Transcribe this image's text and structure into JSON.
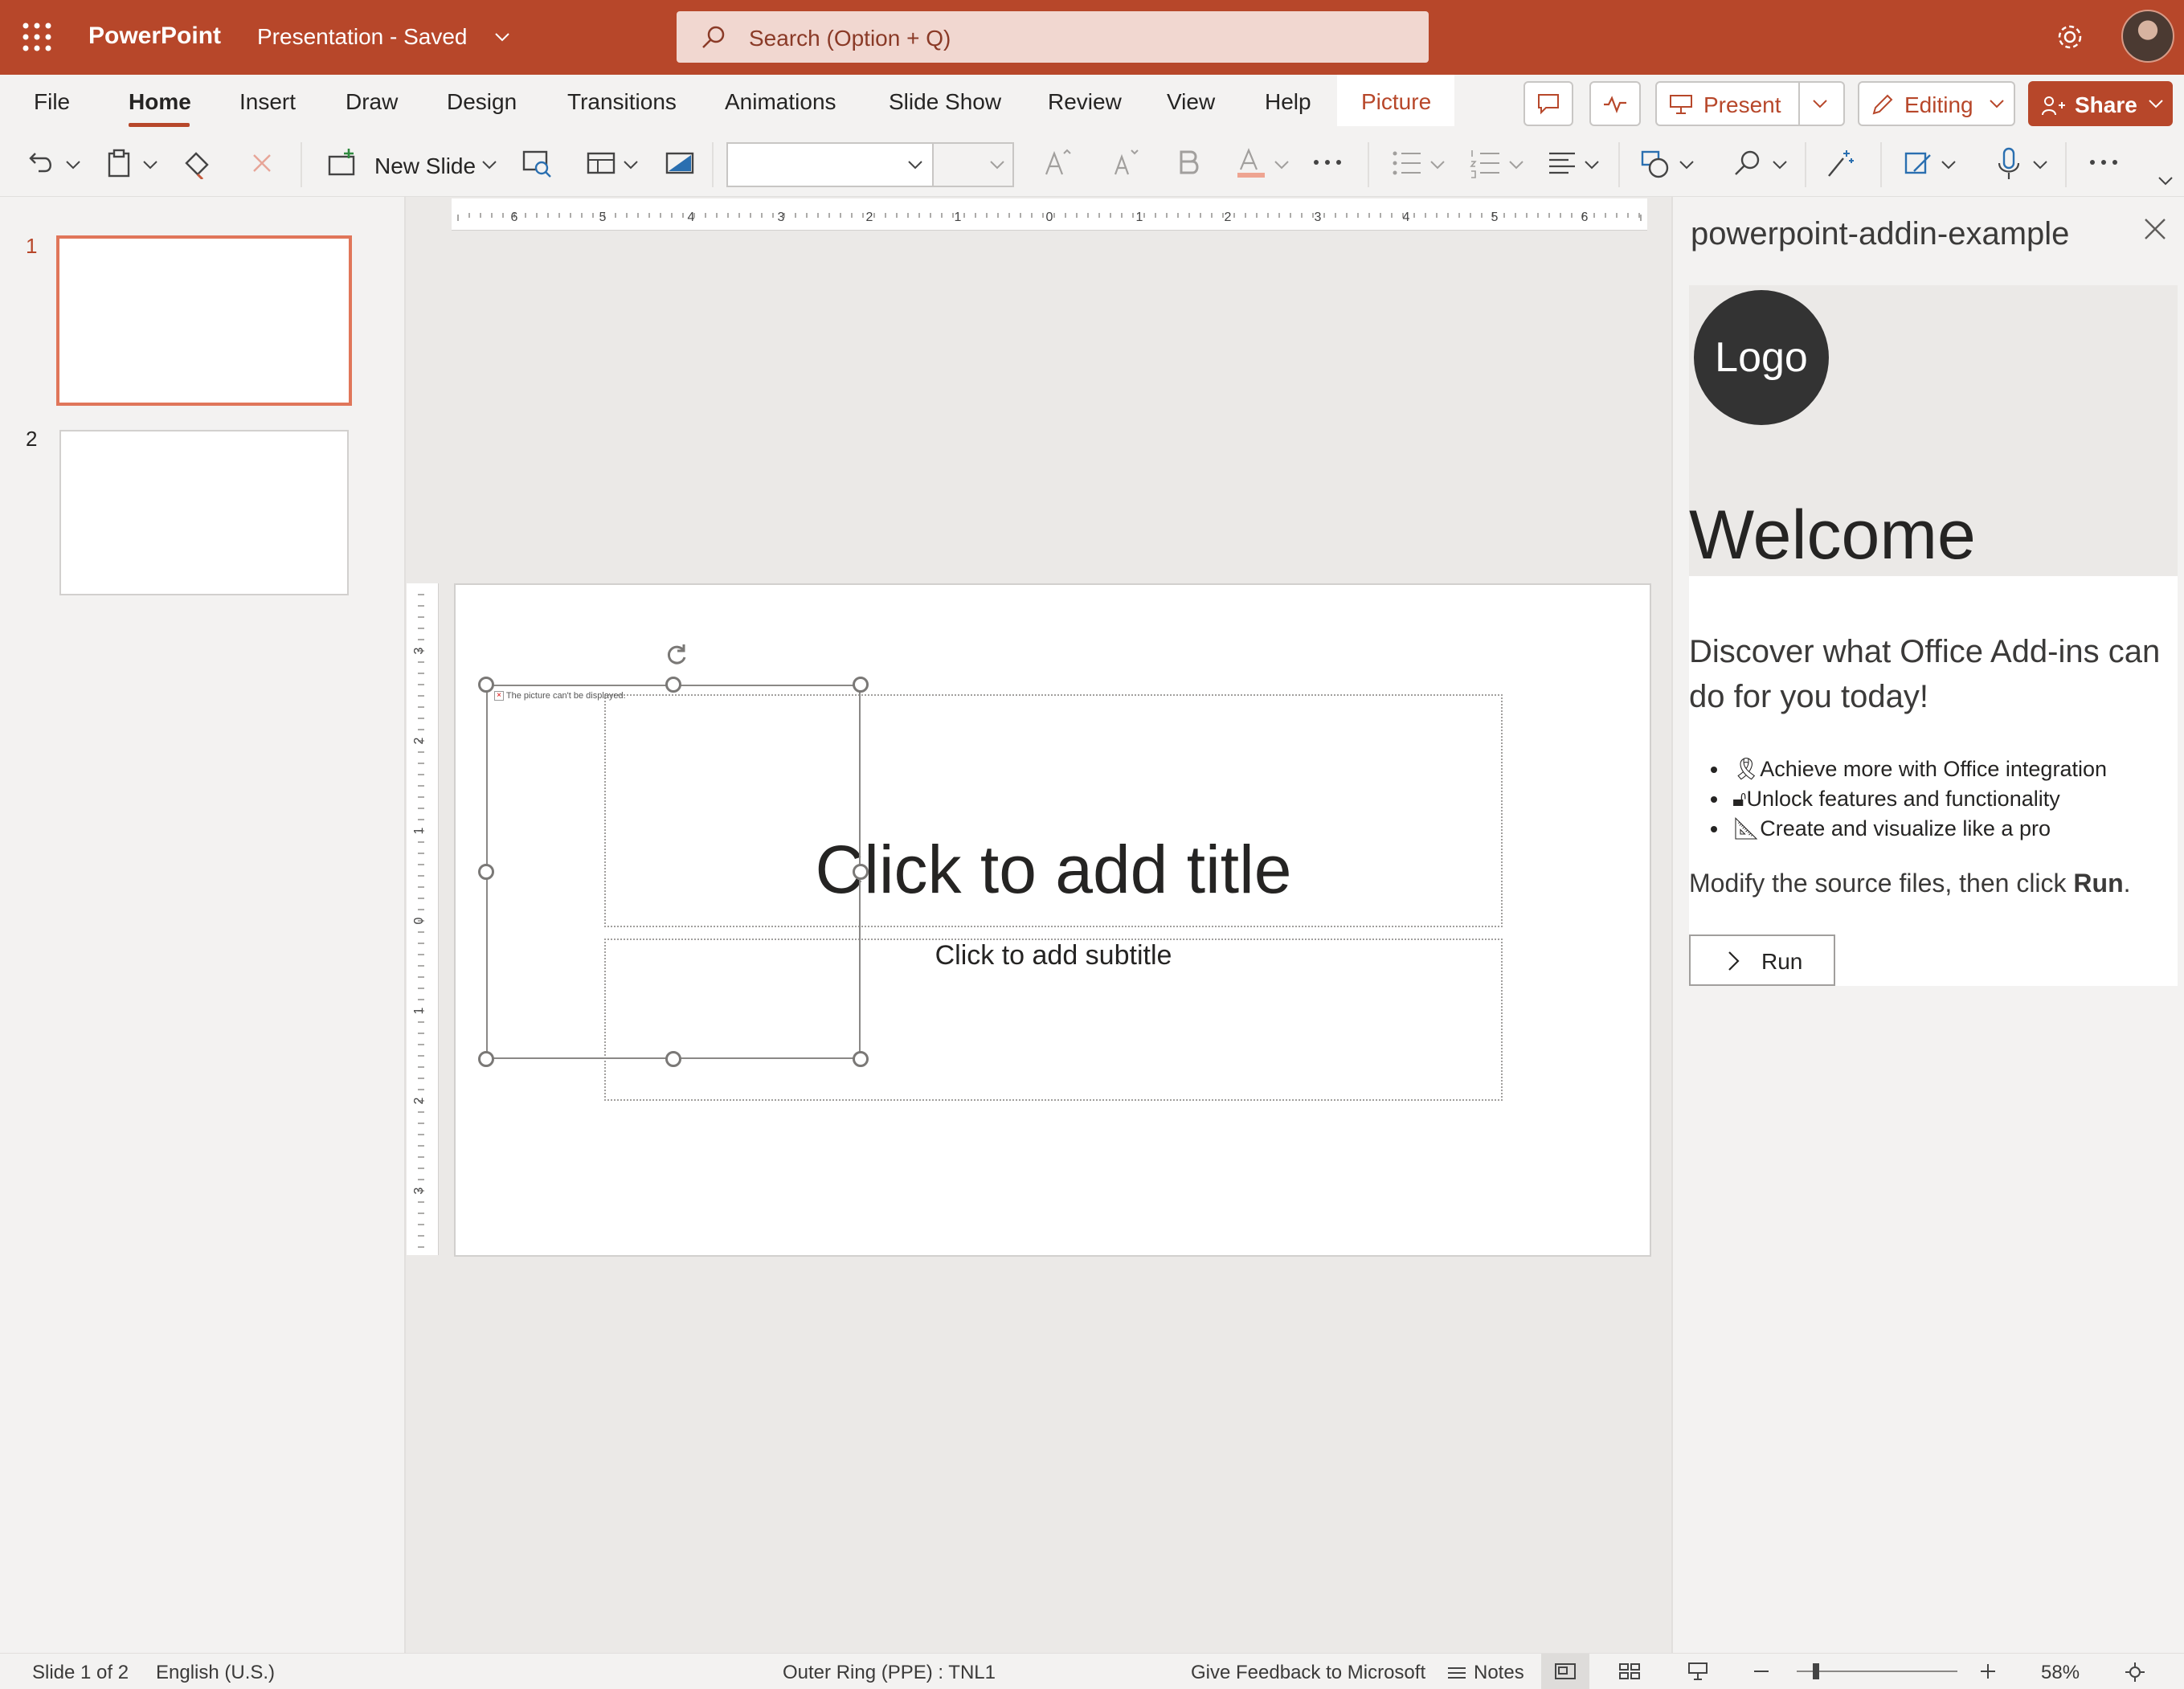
{
  "titlebar": {
    "app_name": "PowerPoint",
    "doc_name": "Presentation  -  Saved",
    "search_placeholder": "Search (Option + Q)",
    "brand_color": "#b7472a"
  },
  "tabs": [
    {
      "label": "File"
    },
    {
      "label": "Home"
    },
    {
      "label": "Insert"
    },
    {
      "label": "Draw"
    },
    {
      "label": "Design"
    },
    {
      "label": "Transitions"
    },
    {
      "label": "Animations"
    },
    {
      "label": "Slide Show"
    },
    {
      "label": "Review"
    },
    {
      "label": "View"
    },
    {
      "label": "Help"
    },
    {
      "label": "Picture"
    }
  ],
  "actions": {
    "present": "Present",
    "editing": "Editing",
    "share": "Share"
  },
  "toolbar": {
    "new_slide": "New Slide",
    "font_name": "",
    "font_size": ""
  },
  "slides_pane": {
    "thumbnails": [
      {
        "number": "1"
      },
      {
        "number": "2"
      }
    ]
  },
  "slide": {
    "title_placeholder": "Click to add title",
    "subtitle_placeholder": "Click to add subtitle",
    "picture_error": "The picture can't be displayed."
  },
  "taskpane": {
    "title": "powerpoint-addin-example",
    "logo": "Logo",
    "welcome": "Welcome",
    "discover": "Discover what Office Add-ins can do for you today!",
    "features": [
      "Achieve more with Office integration",
      "Unlock features and functionality",
      "Create and visualize like a pro"
    ],
    "modify_prefix": "Modify the source files, then click ",
    "modify_bold": "Run",
    "modify_suffix": ".",
    "run_button": "Run"
  },
  "statusbar": {
    "slide_count": "Slide 1 of 2",
    "language": "English (U.S.)",
    "ring": "Outer Ring (PPE) : TNL1",
    "feedback": "Give Feedback to Microsoft",
    "notes": "Notes",
    "zoom": "58%"
  }
}
